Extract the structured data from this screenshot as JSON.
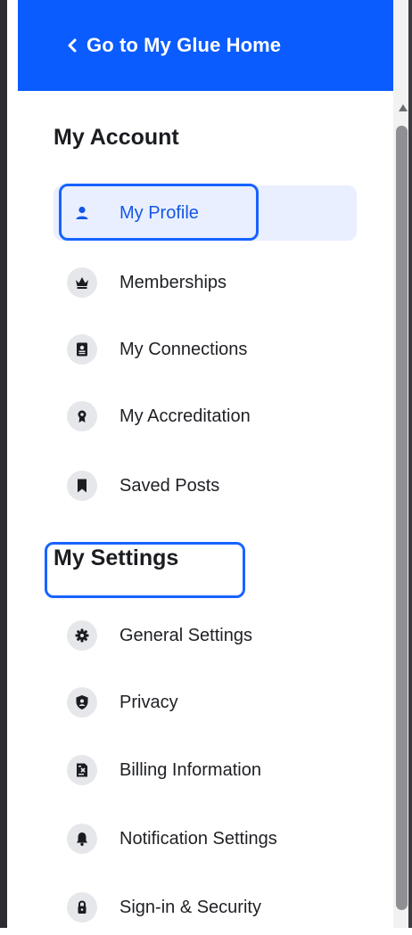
{
  "header": {
    "back_link_label": "Go to My Glue Home",
    "background": "#0a5cff"
  },
  "account": {
    "title": "My Account",
    "items": [
      {
        "label": "My Profile",
        "icon": "person-icon",
        "active": true
      },
      {
        "label": "Memberships",
        "icon": "crown-icon"
      },
      {
        "label": "My Connections",
        "icon": "contact-card-icon"
      },
      {
        "label": "My Accreditation",
        "icon": "award-badge-icon"
      },
      {
        "label": "Saved Posts",
        "icon": "bookmark-icon"
      }
    ]
  },
  "settings": {
    "title": "My Settings",
    "items": [
      {
        "label": "General Settings",
        "icon": "gear-icon"
      },
      {
        "label": "Privacy",
        "icon": "shield-user-icon"
      },
      {
        "label": "Billing Information",
        "icon": "billing-icon"
      },
      {
        "label": "Notification Settings",
        "icon": "bell-icon"
      },
      {
        "label": "Sign-in & Security",
        "icon": "lock-icon"
      }
    ]
  },
  "colors": {
    "accent": "#1457e6",
    "active_bg": "#e9efff",
    "highlight_box": "#1763ff"
  }
}
